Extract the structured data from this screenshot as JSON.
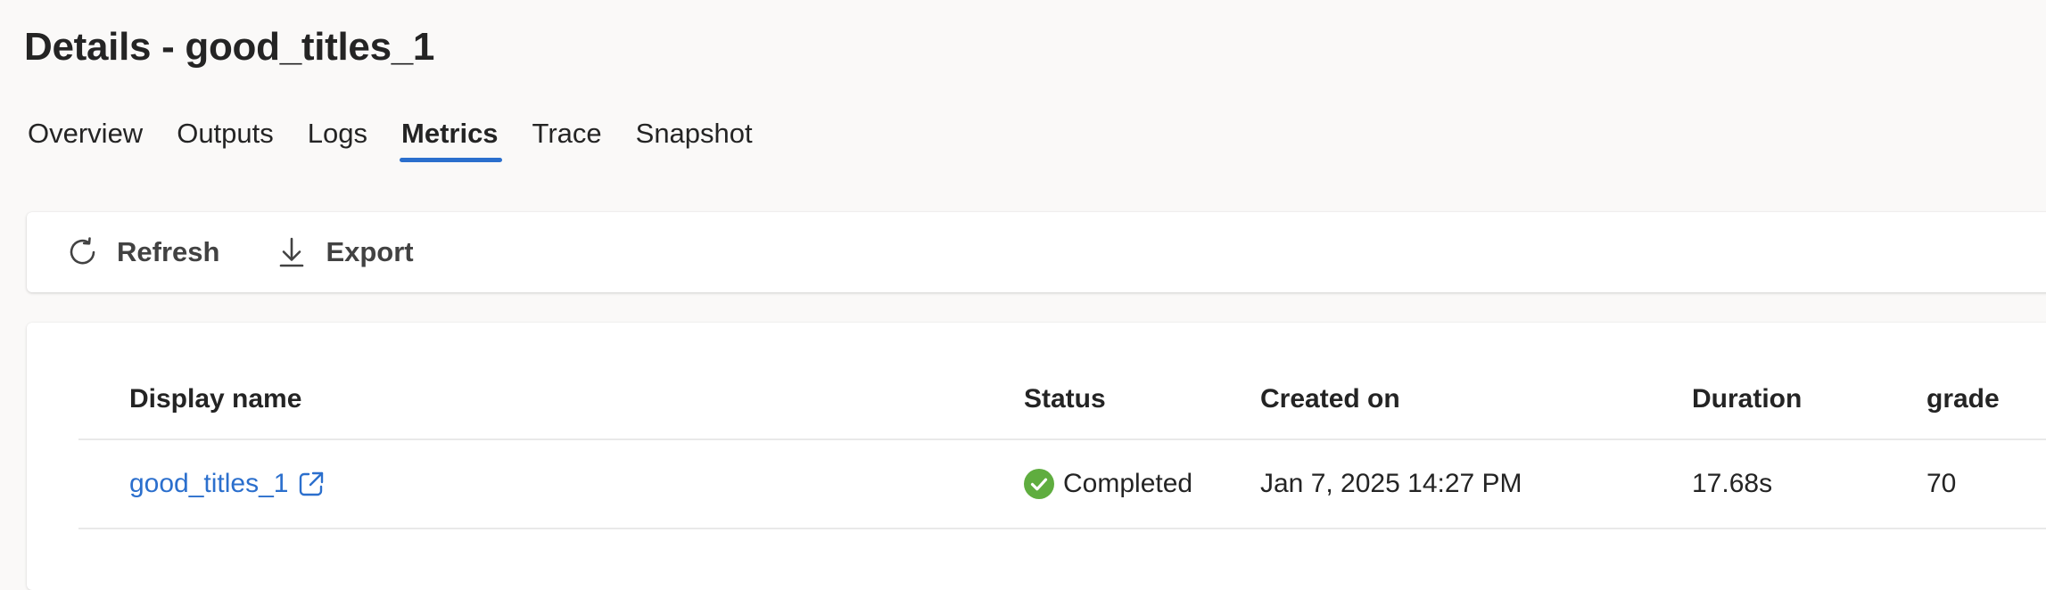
{
  "page": {
    "title": "Details - good_titles_1"
  },
  "tabs": [
    {
      "label": "Overview",
      "active": false
    },
    {
      "label": "Outputs",
      "active": false
    },
    {
      "label": "Logs",
      "active": false
    },
    {
      "label": "Metrics",
      "active": true
    },
    {
      "label": "Trace",
      "active": false
    },
    {
      "label": "Snapshot",
      "active": false
    }
  ],
  "toolbar": {
    "refresh": {
      "label": "Refresh",
      "icon": "refresh-icon"
    },
    "export": {
      "label": "Export",
      "icon": "download-icon"
    }
  },
  "table": {
    "columns": [
      "Display name",
      "Status",
      "Created on",
      "Duration",
      "grade"
    ],
    "rows": [
      {
        "display_name": "good_titles_1",
        "status": "Completed",
        "created_on": "Jan 7, 2025 14:27 PM",
        "duration": "17.68s",
        "grade": "70"
      }
    ]
  },
  "colors": {
    "accent": "#2b6fcd",
    "success": "#5fad3f",
    "text": "#242424"
  }
}
